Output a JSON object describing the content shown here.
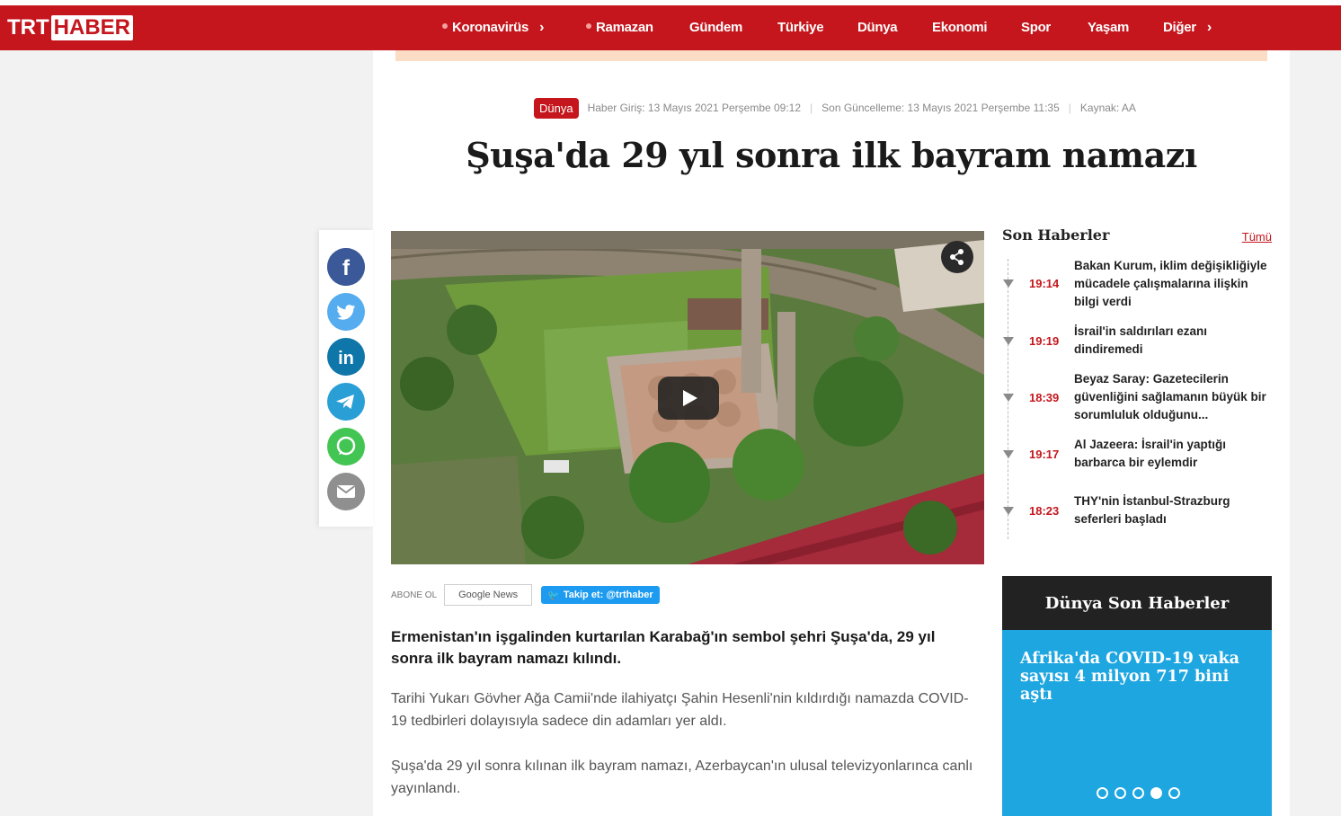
{
  "brand": {
    "part1": "TRT",
    "part2": "HABER"
  },
  "nav": [
    {
      "label": "Koronavirüs",
      "dot": true,
      "chevron": true
    },
    {
      "label": "Ramazan",
      "dot": true,
      "chevron": false
    },
    {
      "label": "Gündem",
      "dot": false,
      "chevron": false
    },
    {
      "label": "Türkiye",
      "dot": false,
      "chevron": false
    },
    {
      "label": "Dünya",
      "dot": false,
      "chevron": false
    },
    {
      "label": "Ekonomi",
      "dot": false,
      "chevron": false
    },
    {
      "label": "Spor",
      "dot": false,
      "chevron": false
    },
    {
      "label": "Yaşam",
      "dot": false,
      "chevron": false
    },
    {
      "label": "Diğer",
      "dot": false,
      "chevron": true
    }
  ],
  "article": {
    "category": "Dünya",
    "published": "Haber Giriş: 13 Mayıs 2021 Perşembe 09:12",
    "updated": "Son Güncelleme: 13 Mayıs 2021 Perşembe 11:35",
    "source": "Kaynak: AA",
    "title": "Şuşa'da 29 yıl sonra ilk bayram namazı",
    "lead": "Ermenistan'ın işgalinden kurtarılan Karabağ'ın sembol şehri Şuşa'da, 29 yıl sonra ilk bayram namazı kılındı.",
    "paragraphs": [
      "Tarihi Yukarı Gövher Ağa Camii'nde ilahiyatçı Şahin Hesenli'nin kıldırdığı namazda COVID-19 tedbirleri dolayısıyla sadece din adamları yer aldı.",
      "Şuşa'da 29 yıl sonra kılınan ilk bayram namazı, Azerbaycan'ın ulusal televizyonlarınca canlı yayınlandı."
    ]
  },
  "share": [
    "facebook-icon",
    "twitter-icon",
    "linkedin-icon",
    "telegram-icon",
    "whatsapp-icon",
    "email-icon"
  ],
  "subscribe": {
    "label": "ABONE OL",
    "google_news": "Google News",
    "twitter": "Takip et: @trthaber"
  },
  "son_haberler": {
    "title": "Son Haberler",
    "all_link": "Tümü",
    "items": [
      {
        "time": "19:14",
        "text": "Bakan Kurum, iklim değişikliğiyle mücadele çalışmalarına ilişkin bilgi verdi"
      },
      {
        "time": "19:19",
        "text": "İsrail'in saldırıları ezanı dindiremedi"
      },
      {
        "time": "18:39",
        "text": "Beyaz Saray: Gazetecilerin güvenliğini sağlamanın büyük bir sorumluluk olduğunu..."
      },
      {
        "time": "19:17",
        "text": "Al Jazeera: İsrail'in yaptığı barbarca bir eylemdir"
      },
      {
        "time": "18:23",
        "text": "THY'nin İstanbul-Strazburg seferleri başladı"
      }
    ]
  },
  "dunya_son": {
    "title": "Dünya Son Haberler",
    "headline": "Afrika'da COVID-19 vaka sayısı 4 milyon 717 bini aştı",
    "active_slide": 4,
    "slide_count": 5
  },
  "colors": {
    "brand_red": "#c4161c",
    "accent_blue": "#1ea6e0"
  }
}
